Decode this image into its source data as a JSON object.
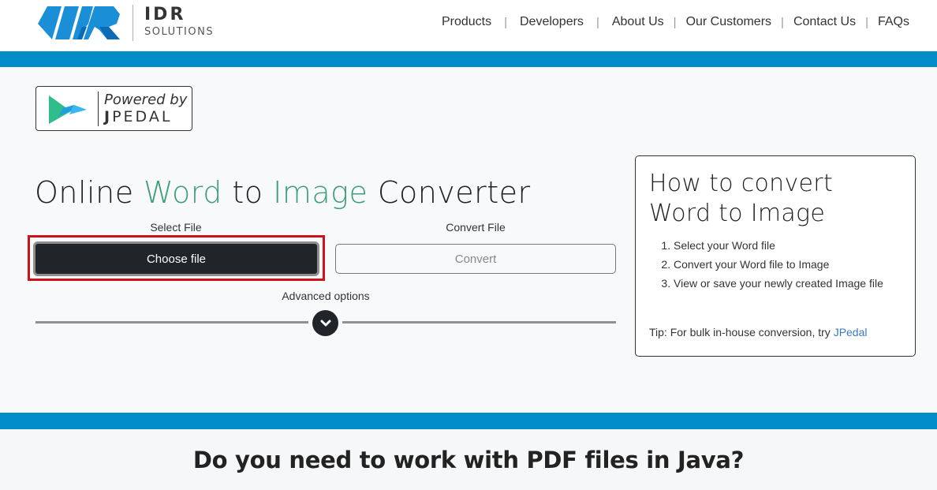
{
  "header": {
    "brand_name": "IDR",
    "brand_sub": "SOLUTIONS",
    "nav": [
      {
        "label": "Products"
      },
      {
        "label": "Developers"
      },
      {
        "label": "About Us"
      },
      {
        "label": "Our Customers"
      },
      {
        "label": "Contact Us"
      },
      {
        "label": "FAQs"
      }
    ],
    "nav_separator": "|"
  },
  "badge": {
    "powered_by": "Powered by",
    "product_initial": "J",
    "product_rest": "PEDAL"
  },
  "converter": {
    "title_parts": {
      "p1": "Online ",
      "accent1": "Word",
      "p2": " to ",
      "accent2": "Image",
      "p3": " Converter"
    },
    "select_label": "Select File",
    "convert_label": "Convert File",
    "choose_button": "Choose file",
    "convert_button": "Convert",
    "advanced_options": "Advanced options"
  },
  "howto": {
    "title_line1": "How to convert",
    "title_line2": "Word to Image",
    "steps": [
      "Select your Word file",
      "Convert your Word file to Image",
      "View or save your newly created Image file"
    ],
    "tip_text": "Tip: For bulk in-house conversion, try ",
    "tip_link": "JPedal"
  },
  "bottom": {
    "heading": "Do you need to work with PDF files in Java?"
  },
  "colors": {
    "brand_blue": "#008cc9",
    "accent_green": "#3e9e7a",
    "highlight_red": "#d0111b",
    "dark_button": "#212529",
    "link_blue": "#3a78c4"
  }
}
